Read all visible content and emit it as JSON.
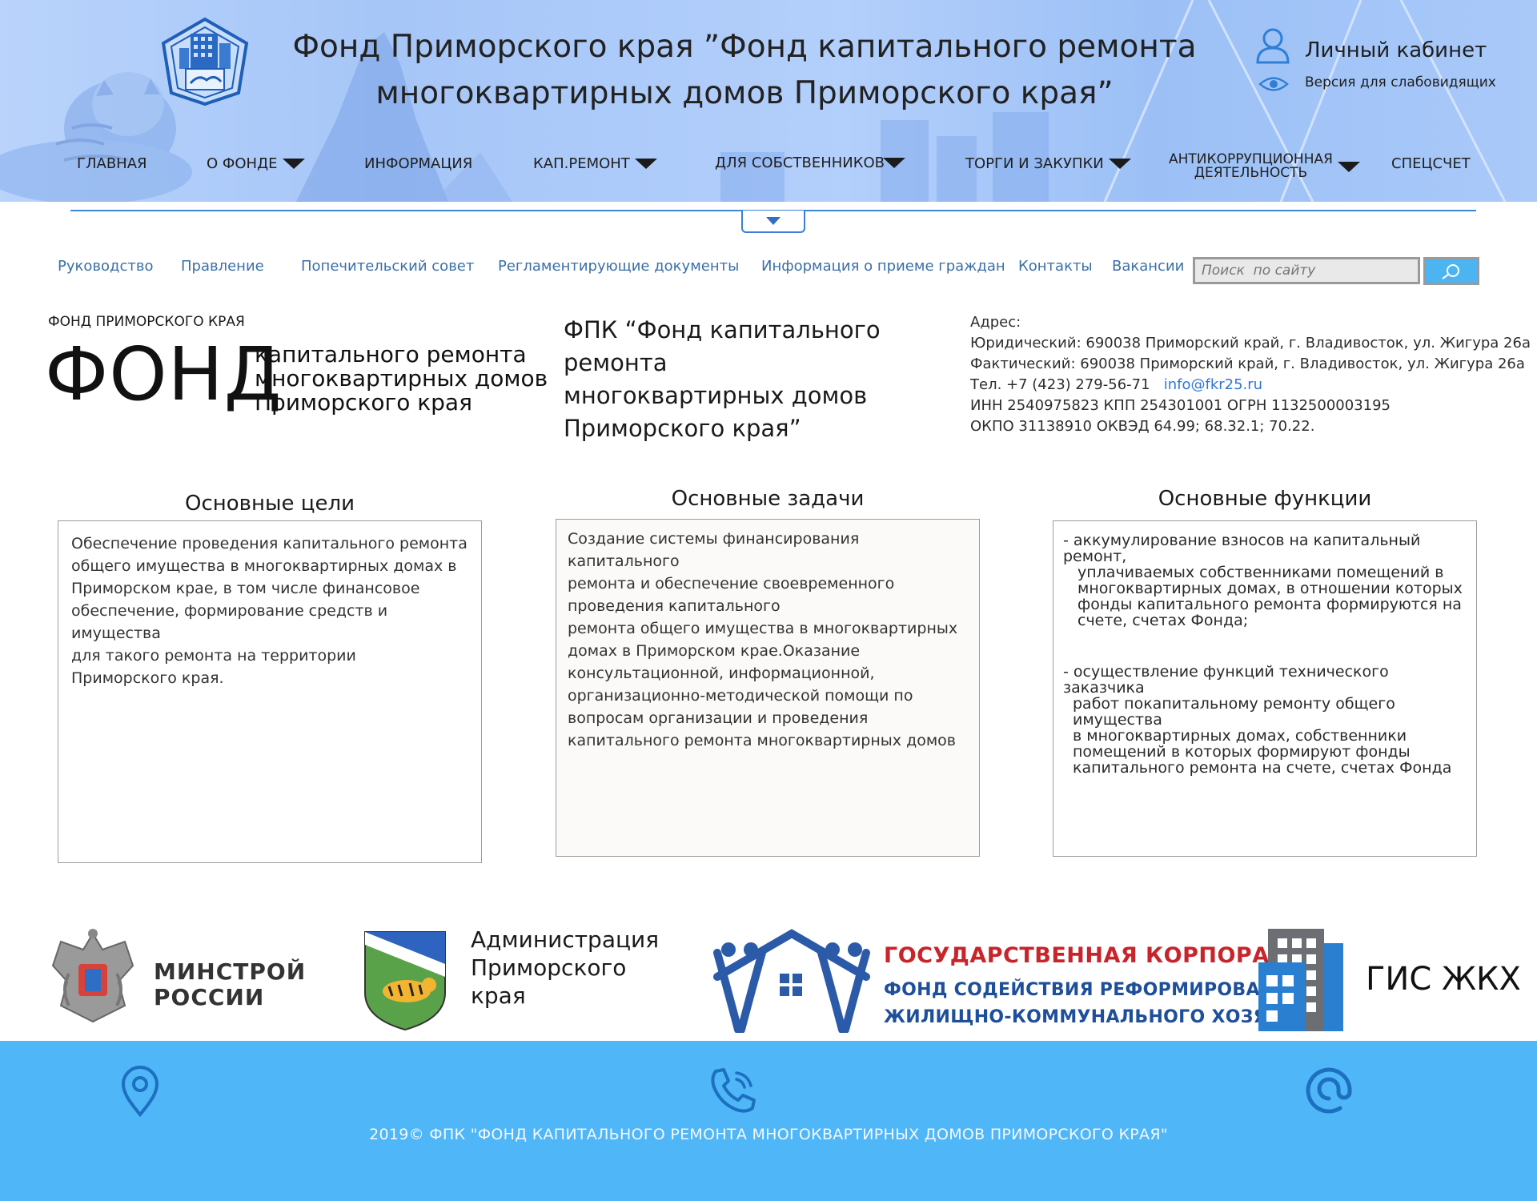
{
  "header": {
    "title_line1": "Фонд Приморского края ”Фонд капитального ремонта",
    "title_line2": "многоквартирных домов Приморского края”",
    "cabinet_label": "Личный кабинет",
    "accessibility_label": "Версия для слабовидящих"
  },
  "main_nav": {
    "items": [
      {
        "label": "ГЛАВНАЯ"
      },
      {
        "label": "О ФОНДЕ"
      },
      {
        "label": "ИНФОРМАЦИЯ"
      },
      {
        "label": "КАП.РЕМОНТ"
      },
      {
        "label": "ДЛЯ  СОБСТВЕННИКОВ"
      },
      {
        "label": "ТОРГИ И ЗАКУПКИ"
      },
      {
        "label_line1": "АНТИКОРРУПЦИОННАЯ",
        "label_line2": "ДЕЯТЕЛЬНОСТЬ"
      },
      {
        "label": "СПЕЦСЧЕТ"
      }
    ]
  },
  "sub_nav": {
    "items": [
      "Руководство",
      "Правление",
      "Попечительский совет",
      "Регламентирующие документы",
      "Информация о приеме граждан",
      "Контакты",
      "Вакансии"
    ],
    "search_placeholder": "Поиск  по сайту"
  },
  "info": {
    "fond_small": "ФОНД ПРИМОРСКОГО КРАЯ",
    "fond_big": "ФОНД",
    "fond_sub": [
      "капитального ремонта",
      "многоквартирных домов",
      "Приморского края"
    ],
    "fpk_lines": [
      "ФПК “Фонд капитального ремонта",
      "многоквартирных домов",
      "Приморского края”"
    ],
    "address": {
      "heading": "Адрес:",
      "legal": "Юридический: 690038 Приморский край, г. Владивосток, ул. Жигура 26а",
      "actual": "Фактический: 690038 Приморский край, г. Владивосток, ул. Жигура 26а",
      "phone": "Тел. +7 (423) 279-56-71",
      "email": "info@fkr25.ru",
      "inn": "ИНН 2540975823 КПП 254301001   ОГРН 1132500003195",
      "okpo": "ОКПО 31138910 ОКВЭД 64.99; 68.32.1; 70.22."
    }
  },
  "columns": {
    "goals": {
      "title": "Основные цели",
      "lines": [
        "Обеспечение проведения капитального ремонта",
        "общего имущества в многоквартирных домах в",
        "Приморском крае, в том числе финансовое",
        "обеспечение, формирование средств и имущества",
        "для такого ремонта на территории",
        "Приморского края."
      ]
    },
    "tasks": {
      "title": "Основные задачи",
      "lines": [
        "Создание системы финансирования капитального",
        "ремонта и обеспечение своевременного",
        "проведения капитального",
        "ремонта общего имущества в многоквартирных",
        "домах в Приморском крае.Оказание",
        "консультационной, информационной,",
        "организационно-методической помощи по",
        "вопросам организации и проведения",
        "капитального ремонта многоквартирных домов"
      ]
    },
    "functions": {
      "title": "Основные функции",
      "item1": [
        "- аккумулирование взносов на капитальный ремонт,",
        "уплачиваемых собственниками помещений в",
        "многоквартирных домах, в отношении которых",
        "фонды капитального ремонта формируются на",
        "счете, счетах Фонда;"
      ],
      "item2": [
        "- осуществление функций технического заказчика",
        "работ покапитальному ремонту общего имущества",
        "в многоквартирных домах, собственники",
        "помещений в которых формируют фонды",
        "капитального ремонта на счете, счетах Фонда"
      ]
    }
  },
  "partners": {
    "minstroy": [
      "МИНСТРОЙ",
      "РОССИИ"
    ],
    "admin": [
      "Администрация",
      "Приморского",
      "края"
    ],
    "gk": [
      "ГОСУДАРСТВЕННАЯ КОРПОРАЦИЯ",
      "ФОНД СОДЕЙСТВИЯ РЕФОРМИРОВАНИЮ",
      "ЖИЛИЩНО-КОММУНАЛЬНОГО ХОЗЯЙСТВА"
    ],
    "gis": "ГИС ЖКХ"
  },
  "footer": {
    "copyright": "2019© ФПК \"ФОНД КАПИТАЛЬНОГО РЕМОНТА МНОГОКВАРТИРНЫХ ДОМОВ ПРИМОРСКОГО КРАЯ\"",
    "icons": [
      "location-icon",
      "phone-icon",
      "at-icon"
    ]
  },
  "colors": {
    "header_bg": "#a9c9f9",
    "footer_bg": "#4fb6f8",
    "link": "#3b6fa8",
    "accent_blue": "#2f78d6",
    "gk_red": "#c8242b",
    "gk_blue": "#1e4f9a"
  }
}
